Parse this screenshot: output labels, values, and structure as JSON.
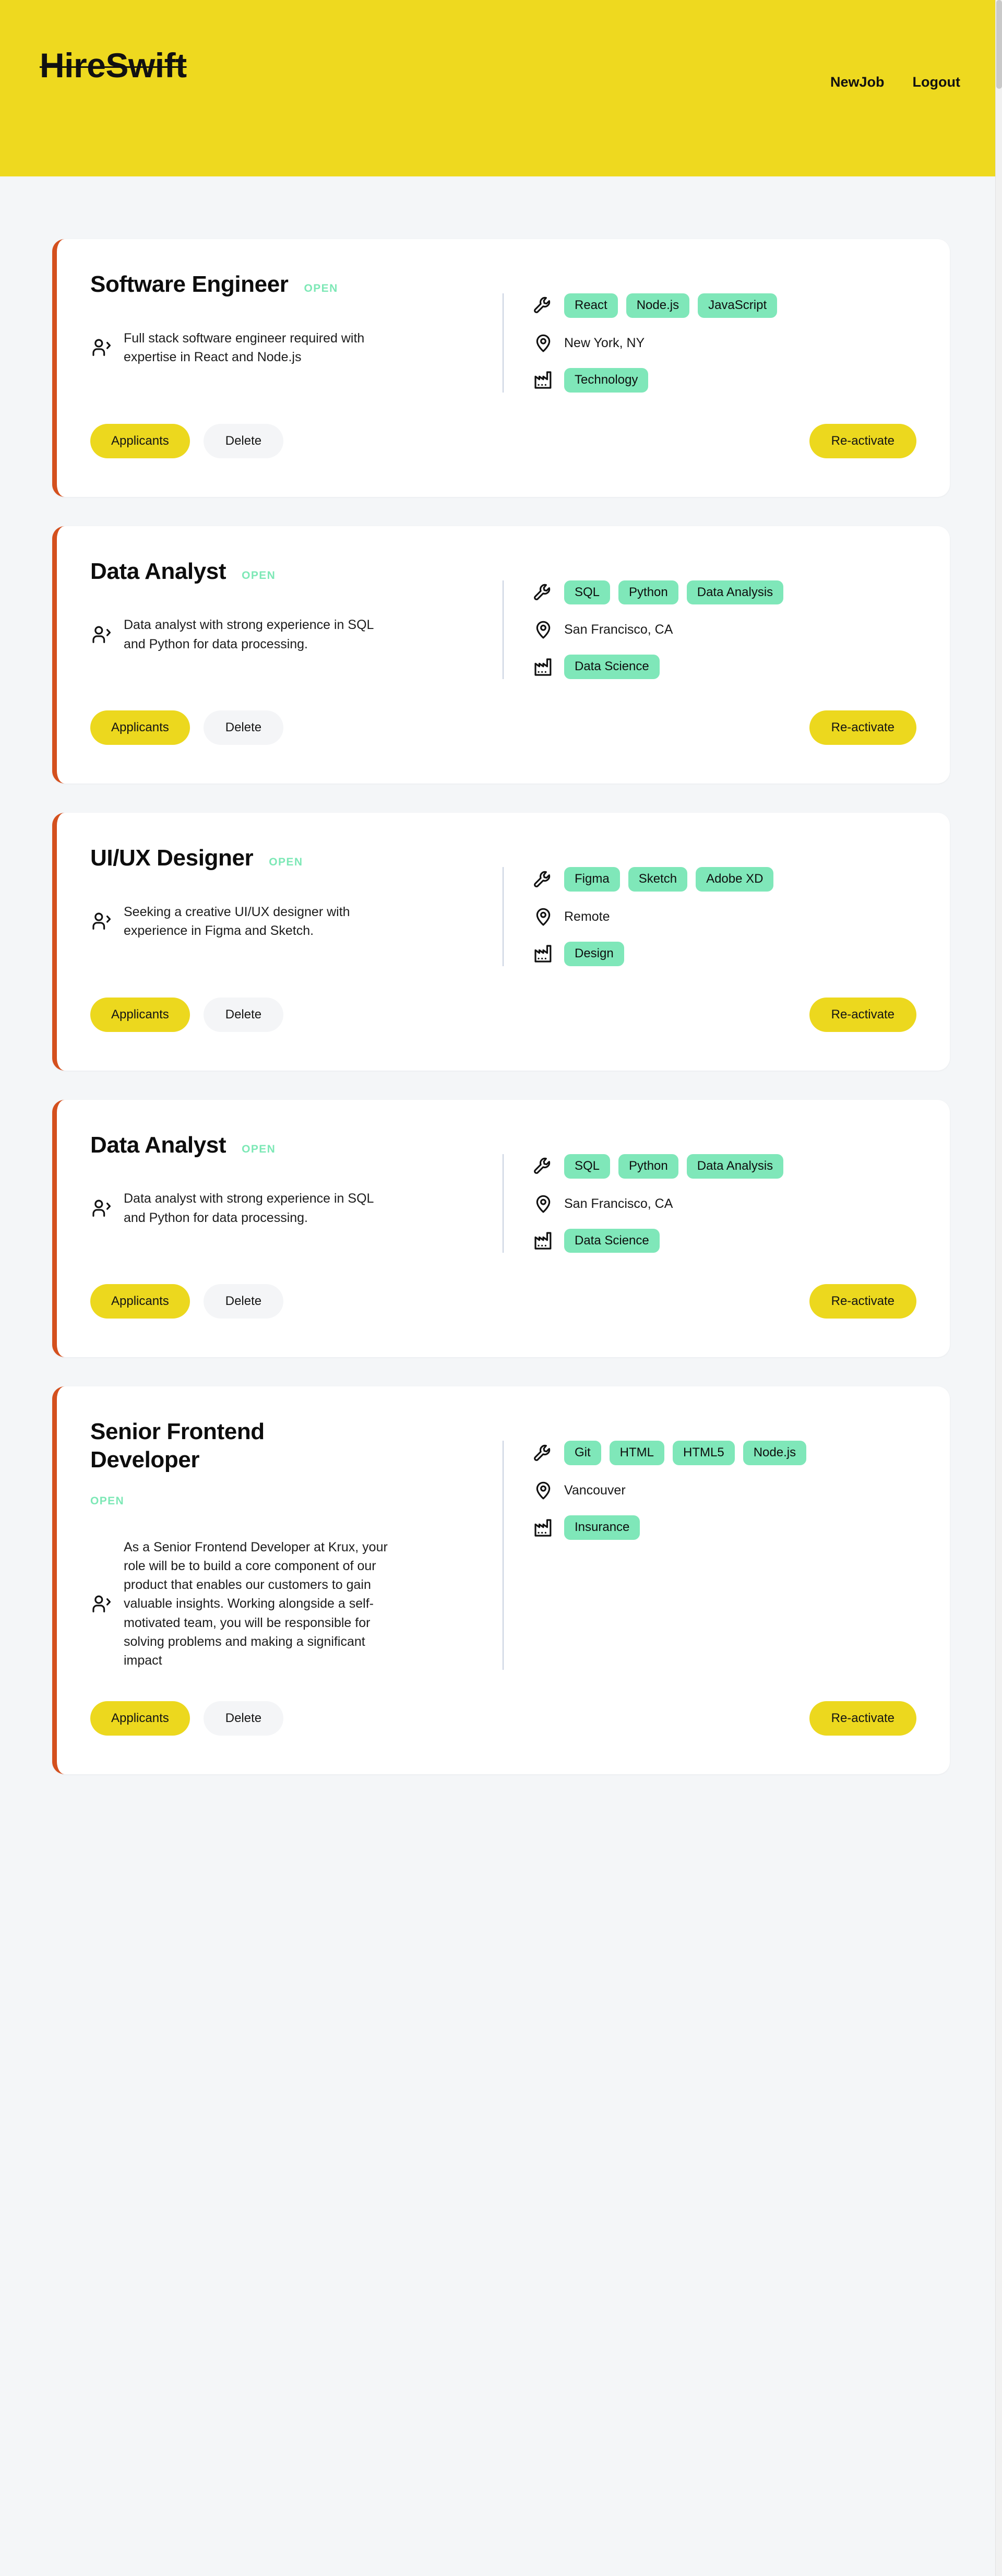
{
  "header": {
    "brand": "HireSwift",
    "nav": [
      {
        "label": "NewJob",
        "name": "nav-link-newjob"
      },
      {
        "label": "Logout",
        "name": "nav-link-logout"
      }
    ]
  },
  "icons": {
    "skills": "wrench-icon",
    "location": "location-pin-icon",
    "industry": "factory-icon",
    "description": "person-icon"
  },
  "buttons": {
    "applicants": "Applicants",
    "delete": "Delete",
    "reactivate": "Re-activate"
  },
  "colors": {
    "header_background": "#eed91f",
    "page_background": "#f4f6f8",
    "card_accent_border": "#d4501e",
    "status_open": "#7de8b6",
    "tag_background": "#7fe7b9",
    "primary_button": "#ecd81e",
    "ghost_button": "#f4f5f7",
    "divider": "#c7d0e0"
  },
  "jobs": [
    {
      "title": "Software Engineer",
      "status": "OPEN",
      "description": "Full stack software engineer required with expertise in React and Node.js",
      "skills": [
        "React",
        "Node.js",
        "JavaScript"
      ],
      "location": "New York, NY",
      "industry": [
        "Technology"
      ],
      "stacked_title": false
    },
    {
      "title": "Data Analyst",
      "status": "OPEN",
      "description": "Data analyst with strong experience in SQL and Python for data processing.",
      "skills": [
        "SQL",
        "Python",
        "Data Analysis"
      ],
      "location": "San Francisco, CA",
      "industry": [
        "Data Science"
      ],
      "stacked_title": false
    },
    {
      "title": "UI/UX Designer",
      "status": "OPEN",
      "description": "Seeking a creative UI/UX designer with experience in Figma and Sketch.",
      "skills": [
        "Figma",
        "Sketch",
        "Adobe XD"
      ],
      "location": "Remote",
      "industry": [
        "Design"
      ],
      "stacked_title": false
    },
    {
      "title": "Data Analyst",
      "status": "OPEN",
      "description": "Data analyst with strong experience in SQL and Python for data processing.",
      "skills": [
        "SQL",
        "Python",
        "Data Analysis"
      ],
      "location": "San Francisco, CA",
      "industry": [
        "Data Science"
      ],
      "stacked_title": false
    },
    {
      "title": "Senior Frontend Developer",
      "status": "OPEN",
      "description": "As a Senior Frontend Developer at Krux, your role will be to build a core component of our product that enables our customers to gain valuable insights. Working alongside a self-motivated team, you will be responsible for solving problems and making a significant impact",
      "skills": [
        "Git",
        "HTML",
        "HTML5",
        "Node.js"
      ],
      "location": "Vancouver",
      "industry": [
        "Insurance"
      ],
      "stacked_title": true
    }
  ]
}
